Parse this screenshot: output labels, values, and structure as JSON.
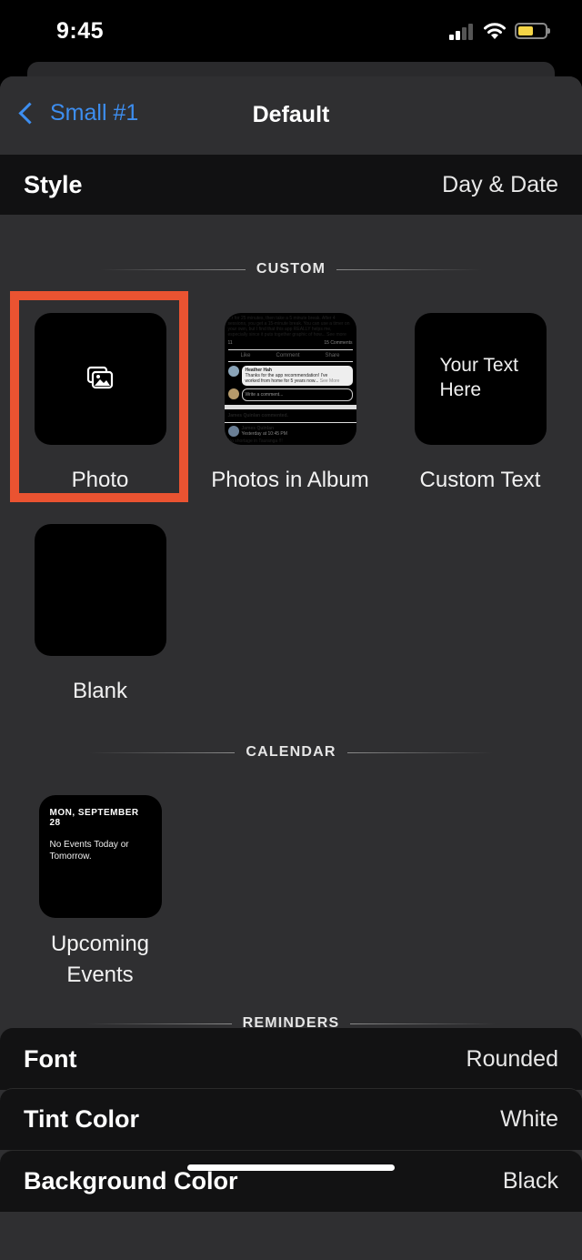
{
  "status": {
    "time": "9:45"
  },
  "nav": {
    "back_label": "Small #1",
    "title": "Default"
  },
  "style_row": {
    "label": "Style",
    "value": "Day & Date"
  },
  "sections": {
    "custom": "CUSTOM",
    "calendar": "CALENDAR",
    "reminders": "REMINDERS"
  },
  "tiles": {
    "photo": "Photo",
    "photos_in_album": "Photos in Album",
    "custom_text": "Custom Text",
    "custom_text_preview": [
      "Your Text",
      "Here"
    ],
    "blank": "Blank",
    "upcoming_events": [
      "Upcoming",
      "Events"
    ]
  },
  "calendar_preview": {
    "date": "MON, SEPTEMBER 28",
    "events": [
      "No Events Today or",
      "Tomorrow."
    ]
  },
  "album_preview": {
    "snippet": [
      "...r for 25 minutes, then take a 5 minute break. After 4",
      "sessions, you get a 15-minute break. You can use a timer on",
      "your own, but I find that this app REALLY helps me,",
      "especially since it puts together graphic of how... See more"
    ],
    "reactions": "11",
    "comments_count": "15 Comments",
    "actions": [
      "Like",
      "Comment",
      "Share"
    ],
    "comment_author": "Heather Hah",
    "comment_text": [
      "Thanks for the app recommendation! I've",
      "worked from home for 5 years now..."
    ],
    "see_more": "See More",
    "write_placeholder": "Write a comment...",
    "notification": "James Quinlan commented.",
    "post_author": "James Quinlan",
    "post_time": "Yesterday at 10:45 PM",
    "post_text": "No shortage in Tauranga !!!"
  },
  "rows": {
    "font": {
      "label": "Font",
      "value": "Rounded"
    },
    "tint": {
      "label": "Tint Color",
      "value": "White"
    },
    "background": {
      "label": "Background Color",
      "value": "Black"
    }
  },
  "colors": {
    "accent": "#3d8ef0",
    "selection": "#ea5331",
    "battery": "#f5d547"
  }
}
